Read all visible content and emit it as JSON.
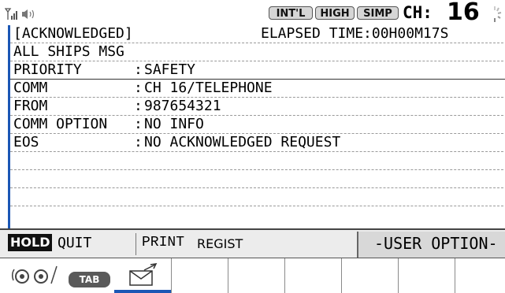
{
  "status_bar": {
    "signal_icon": "signal-icon",
    "speaker_icon": "speaker-icon",
    "badges": [
      "INT'L",
      "HIGH",
      "SIMP"
    ],
    "channel_label": "CH:",
    "channel_value": "16",
    "busy_icon": "spinner-icon"
  },
  "message": {
    "state": "[ACKNOWLEDGED]",
    "elapsed": "ELAPSED TIME:00H00M17S",
    "title": "ALL SHIPS MSG",
    "fields": [
      {
        "key": "PRIORITY",
        "value": "SAFETY"
      },
      {
        "key": "COMM",
        "value": "CH 16/TELEPHONE"
      },
      {
        "key": "FROM",
        "value": "987654321"
      },
      {
        "key": "COMM OPTION",
        "value": "NO INFO"
      },
      {
        "key": "EOS",
        "value": "NO ACKNOWLEDGED REQUEST"
      }
    ],
    "colon": ":"
  },
  "softkeys": {
    "hold": "HOLD",
    "quit": "QUIT",
    "print": "PRINT",
    "regist": "REGIST",
    "user_option": "-USER OPTION-"
  },
  "tabs": {
    "tab_label": "TAB",
    "knob_icon": "rotary-knob-icon",
    "mail_icon": "outgoing-mail-icon"
  },
  "colors": {
    "accent_blue": "#1b57b5",
    "badge_bg": "#d6d6d6",
    "softkey_bg": "#ececec"
  }
}
